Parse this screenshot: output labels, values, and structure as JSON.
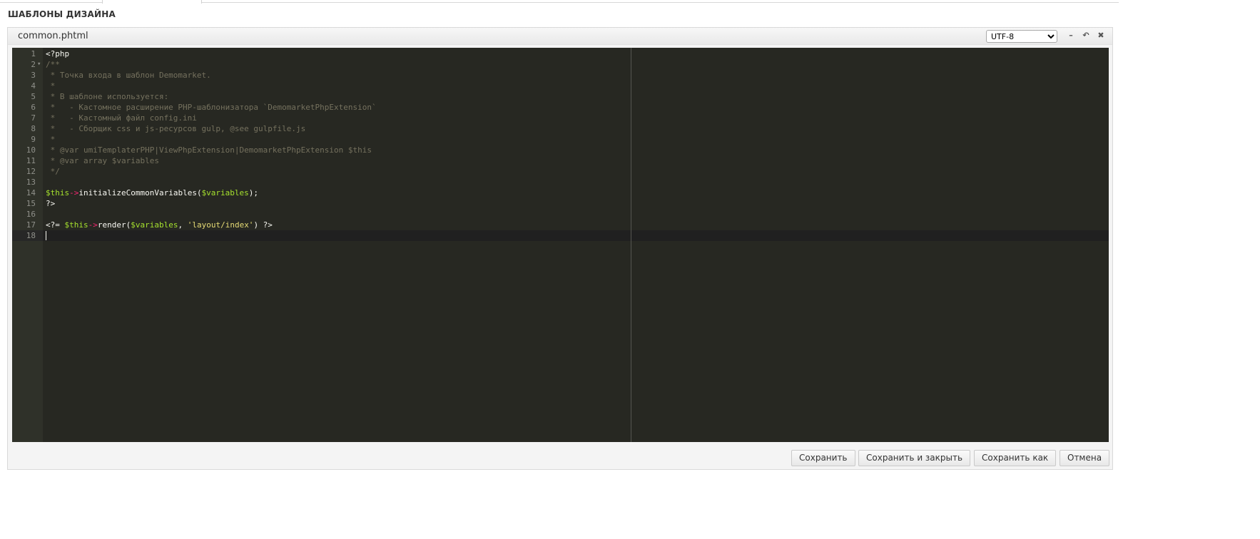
{
  "page": {
    "title": "ШАБЛОНЫ ДИЗАЙНА"
  },
  "panel": {
    "file_name": "common.phtml",
    "encoding": {
      "selected": "UTF-8",
      "options": [
        "UTF-8"
      ]
    },
    "icons": [
      "minimize-icon",
      "restore-icon",
      "close-icon"
    ]
  },
  "editor": {
    "theme_colors": {
      "background": "#272822",
      "gutter": "#2f3129",
      "comment": "#75715e",
      "variable": "#a6e22e",
      "operator": "#f92672",
      "string": "#e6db74",
      "text": "#f8f8f2"
    },
    "active_line": 18,
    "lines": [
      {
        "n": "1",
        "fold": "",
        "tokens": [
          {
            "t": "<?php",
            "c": "plain"
          }
        ]
      },
      {
        "n": "2",
        "fold": "▾",
        "tokens": [
          {
            "t": "/**",
            "c": "comment"
          }
        ]
      },
      {
        "n": "3",
        "fold": "",
        "tokens": [
          {
            "t": " * Точка входа в шаблон Demomarket.",
            "c": "comment"
          }
        ]
      },
      {
        "n": "4",
        "fold": "",
        "tokens": [
          {
            "t": " *",
            "c": "comment"
          }
        ]
      },
      {
        "n": "5",
        "fold": "",
        "tokens": [
          {
            "t": " * В шаблоне используется:",
            "c": "comment"
          }
        ]
      },
      {
        "n": "6",
        "fold": "",
        "tokens": [
          {
            "t": " *   - Кастомное расширение PHP-шаблонизатора `DemomarketPhpExtension`",
            "c": "comment"
          }
        ]
      },
      {
        "n": "7",
        "fold": "",
        "tokens": [
          {
            "t": " *   - Кастомный файл config.ini",
            "c": "comment"
          }
        ]
      },
      {
        "n": "8",
        "fold": "",
        "tokens": [
          {
            "t": " *   - Сборщик css и js-ресурсов gulp, @see gulpfile.js",
            "c": "comment"
          }
        ]
      },
      {
        "n": "9",
        "fold": "",
        "tokens": [
          {
            "t": " *",
            "c": "comment"
          }
        ]
      },
      {
        "n": "10",
        "fold": "",
        "tokens": [
          {
            "t": " * @var umiTemplaterPHP|ViewPhpExtension|DemomarketPhpExtension $this",
            "c": "comment"
          }
        ]
      },
      {
        "n": "11",
        "fold": "",
        "tokens": [
          {
            "t": " * @var array $variables",
            "c": "comment"
          }
        ]
      },
      {
        "n": "12",
        "fold": "",
        "tokens": [
          {
            "t": " */",
            "c": "comment"
          }
        ]
      },
      {
        "n": "13",
        "fold": "",
        "tokens": []
      },
      {
        "n": "14",
        "fold": "",
        "tokens": [
          {
            "t": "$this",
            "c": "var"
          },
          {
            "t": "->",
            "c": "op"
          },
          {
            "t": "initializeCommonVariables(",
            "c": "plain"
          },
          {
            "t": "$variables",
            "c": "var"
          },
          {
            "t": ");",
            "c": "plain"
          }
        ]
      },
      {
        "n": "15",
        "fold": "",
        "tokens": [
          {
            "t": "?>",
            "c": "plain"
          }
        ]
      },
      {
        "n": "16",
        "fold": "",
        "tokens": []
      },
      {
        "n": "17",
        "fold": "",
        "tokens": [
          {
            "t": "<?= ",
            "c": "plain"
          },
          {
            "t": "$this",
            "c": "var"
          },
          {
            "t": "->",
            "c": "op"
          },
          {
            "t": "render(",
            "c": "plain"
          },
          {
            "t": "$variables",
            "c": "var"
          },
          {
            "t": ", ",
            "c": "plain"
          },
          {
            "t": "'layout/index'",
            "c": "str"
          },
          {
            "t": ") ?>",
            "c": "plain"
          }
        ]
      },
      {
        "n": "18",
        "fold": "",
        "tokens": []
      }
    ]
  },
  "footer": {
    "save_label": "Сохранить",
    "save_close_label": "Сохранить и закрыть",
    "save_as_label": "Сохранить как",
    "cancel_label": "Отмена"
  }
}
